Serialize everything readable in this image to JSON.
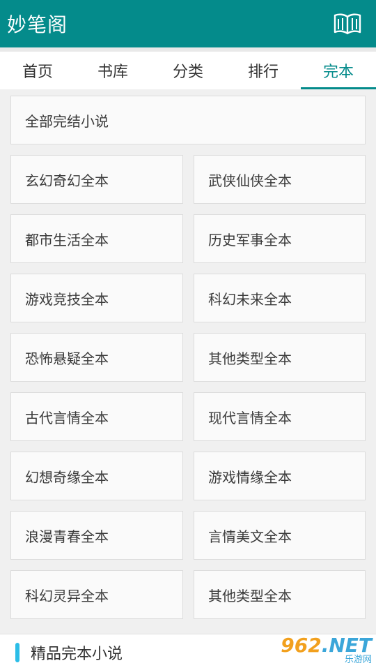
{
  "header": {
    "title": "妙笔阁",
    "icon": "open-book-icon"
  },
  "tabs": [
    {
      "label": "首页",
      "active": false
    },
    {
      "label": "书库",
      "active": false
    },
    {
      "label": "分类",
      "active": false
    },
    {
      "label": "排行",
      "active": false
    },
    {
      "label": "完本",
      "active": true
    }
  ],
  "full_item": {
    "label": "全部完结小说"
  },
  "items": [
    {
      "label": "玄幻奇幻全本"
    },
    {
      "label": "武侠仙侠全本"
    },
    {
      "label": "都市生活全本"
    },
    {
      "label": "历史军事全本"
    },
    {
      "label": "游戏竞技全本"
    },
    {
      "label": "科幻未来全本"
    },
    {
      "label": "恐怖悬疑全本"
    },
    {
      "label": "其他类型全本"
    },
    {
      "label": "古代言情全本"
    },
    {
      "label": "现代言情全本"
    },
    {
      "label": "幻想奇缘全本"
    },
    {
      "label": "游戏情缘全本"
    },
    {
      "label": "浪漫青春全本"
    },
    {
      "label": "言情美文全本"
    },
    {
      "label": "科幻灵异全本"
    },
    {
      "label": "其他类型全本"
    }
  ],
  "footer": {
    "title": "精品完本小说"
  },
  "watermark": {
    "main": "962",
    "dot": ".",
    "tld": "NET",
    "sub": "乐游网"
  },
  "colors": {
    "primary": "#048b8b",
    "accent": "#2bbde7"
  }
}
